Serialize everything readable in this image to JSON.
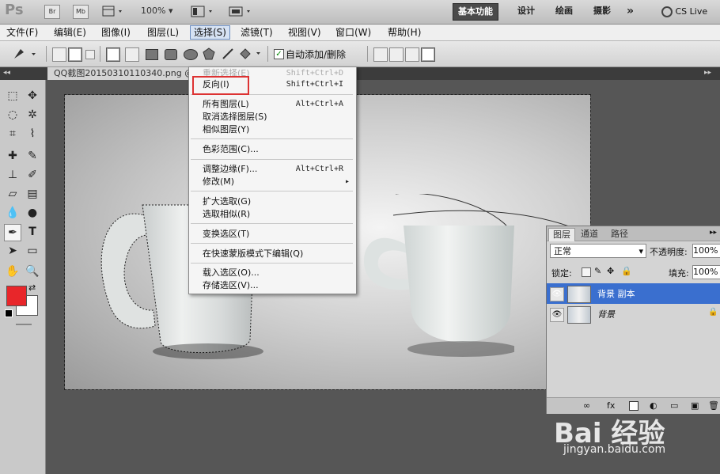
{
  "app": {
    "logo": "Ps",
    "bridge": "Br",
    "minibridge": "Mb",
    "zoom": "100%",
    "workspace_buttons": [
      "基本功能",
      "设计",
      "绘画",
      "摄影"
    ],
    "more": "»",
    "cslive": "CS Live"
  },
  "menubar": [
    "文件(F)",
    "编辑(E)",
    "图像(I)",
    "图层(L)",
    "选择(S)",
    "滤镜(T)",
    "视图(V)",
    "窗口(W)",
    "帮助(H)"
  ],
  "options": {
    "auto_add_delete": "自动添加/删除"
  },
  "document": {
    "tab_title": "QQ截图20150310110340.png @"
  },
  "select_menu": {
    "items": [
      {
        "label": "重新选择(E)",
        "shortcut": "Shift+Ctrl+D",
        "dim": true
      },
      {
        "label": "反向(I)",
        "shortcut": "Shift+Ctrl+I"
      },
      {
        "label": "所有图层(L)",
        "shortcut": "Alt+Ctrl+A"
      },
      {
        "label": "取消选择图层(S)",
        "shortcut": ""
      },
      {
        "label": "相似图层(Y)",
        "shortcut": ""
      },
      {
        "label": "色彩范围(C)...",
        "shortcut": ""
      },
      {
        "label": "调整边缘(F)...",
        "shortcut": "Alt+Ctrl+R"
      },
      {
        "label": "修改(M)",
        "shortcut": "▸"
      },
      {
        "label": "扩大选取(G)",
        "shortcut": ""
      },
      {
        "label": "选取相似(R)",
        "shortcut": ""
      },
      {
        "label": "变换选区(T)",
        "shortcut": ""
      },
      {
        "label": "在快速蒙版模式下编辑(Q)",
        "shortcut": ""
      },
      {
        "label": "载入选区(O)...",
        "shortcut": ""
      },
      {
        "label": "存储选区(V)...",
        "shortcut": ""
      }
    ]
  },
  "layers_panel": {
    "tabs": [
      "图层",
      "通道",
      "路径"
    ],
    "blend_mode": "正常",
    "opacity_label": "不透明度:",
    "opacity_value": "100%",
    "lock_label": "锁定:",
    "fill_label": "填充:",
    "fill_value": "100%",
    "layers": [
      {
        "name": "背景 副本",
        "selected": true
      },
      {
        "name": "背景",
        "selected": false
      }
    ]
  },
  "colors": {
    "foreground": "#e8262a",
    "background": "#ffffff",
    "selected_layer": "#3a6fcf",
    "highlight_box": "#dd3333"
  },
  "watermark": {
    "brand": "Bai 经验",
    "url": "jingyan.baidu.com"
  }
}
